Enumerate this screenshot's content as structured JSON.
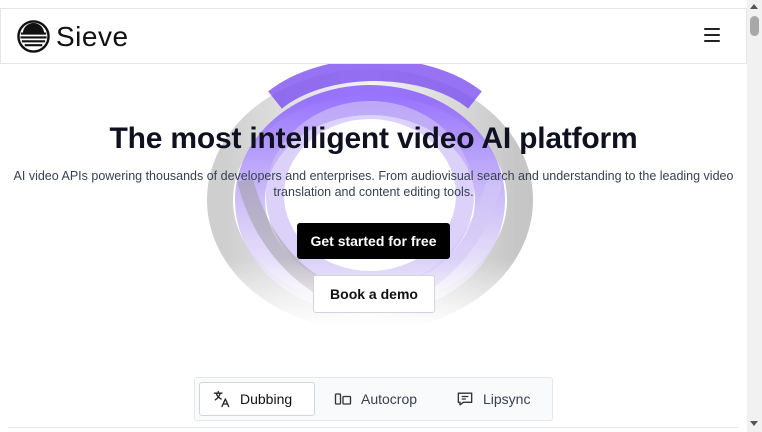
{
  "brand": {
    "name": "Sieve"
  },
  "nav": {
    "menu_icon": "hamburger-menu-icon"
  },
  "hero": {
    "title": "The most intelligent video AI platform",
    "subtitle": "AI video APIs powering thousands of developers and enterprises. From audiovisual search and understanding to the leading video translation and content editing tools.",
    "primary_cta": "Get started for free",
    "secondary_cta": "Book a demo"
  },
  "tabs": [
    {
      "label": "Dubbing",
      "icon": "translate-icon",
      "active": true
    },
    {
      "label": "Autocrop",
      "icon": "crop-frames-icon",
      "active": false
    },
    {
      "label": "Lipsync",
      "icon": "chat-bubble-icon",
      "active": false
    }
  ],
  "colors": {
    "primary_button": "#000000",
    "title": "#0f1120",
    "hero_art_purple": "#8b5cf6"
  }
}
